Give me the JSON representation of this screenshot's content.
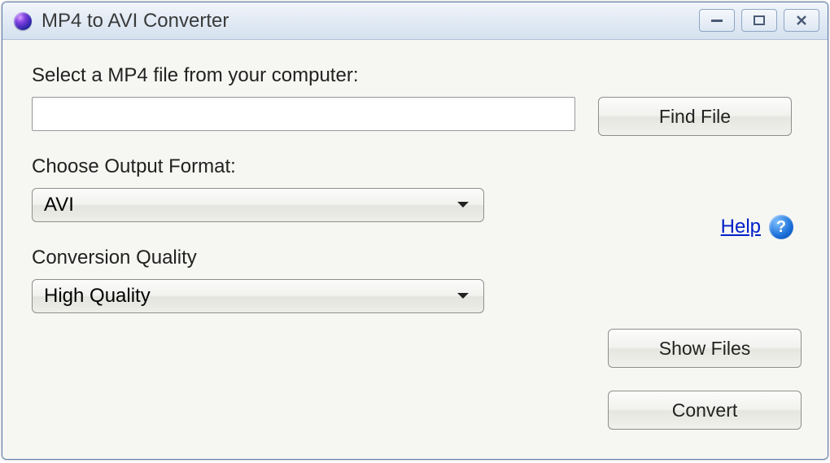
{
  "window": {
    "title": "MP4 to AVI Converter"
  },
  "labels": {
    "select_file": "Select a MP4 file from your computer:",
    "output_format": "Choose Output Format:",
    "conversion_quality": "Conversion Quality"
  },
  "inputs": {
    "file_path": "",
    "output_format_selected": "AVI",
    "quality_selected": "High Quality"
  },
  "buttons": {
    "find_file": "Find File",
    "show_files": "Show Files",
    "convert": "Convert"
  },
  "help": {
    "link_text": "Help",
    "icon_char": "?"
  }
}
